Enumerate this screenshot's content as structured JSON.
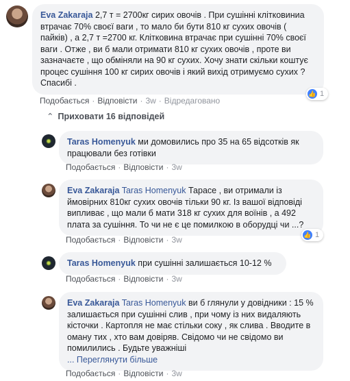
{
  "comments": [
    {
      "author": "Eva Zakaraja",
      "mention": "",
      "text": "2,7 т = 2700кг сирих овочів . При сушінні клітковиниа втрачає 70% своєї ваги , то мало би бути 810 кг сухих овочів ( пайків) , а 2,7 т =2700 кг. Клітковина втрачає при сушінні 70% своєї ваги . Отже , ви б мали отримати 810 кг сухих овочів , проте ви зазначаєте , що обміняли на 90 кг сухих. Хочу знати скільки коштує процес сушіння 100 кг сирих овочів і який вихід отримуємо сухих ? Спасибі .",
      "like": "Подобається",
      "reply": "Відповісти",
      "time": "3w",
      "edited": "Відредаговано",
      "reactions": "1"
    },
    {
      "author": "Taras Homenyuk",
      "mention": "",
      "text": "ми домовились про 35 на 65 відсотків як працювали без готівки",
      "like": "Подобається",
      "reply": "Відповісти",
      "time": "3w"
    },
    {
      "author": "Eva Zakaraja",
      "mention": "Taras Homenyuk",
      "text": "Тарасе , ви отримали із ймовірних 810кг сухих овочів тільки 90 кг. Із вашої відповіді випливає , що мали б мати 318 кг сухих для воїнів , а 492 плата за сушіння. То чи не є це помилкою в обoрудці чи ...?",
      "like": "Подобається",
      "reply": "Відповісти",
      "time": "3w",
      "reactions": "1"
    },
    {
      "author": "Taras Homenyuk",
      "mention": "",
      "text": "при сушінні залишається 10-12 %",
      "like": "Подобається",
      "reply": "Відповісти",
      "time": "3w"
    },
    {
      "author": "Eva Zakaraja",
      "mention": "Taras Homenyuk",
      "text": "ви б глянули у довідники : 15 % залишається при сушінні слив , при чому із них видаляють кісточки . Картопля не має стільки соку , як слива . Вводите в оману тих , хто вам довіряв. Свідомо чи не свідомо ви помилились . Будьте уважніші",
      "more": "... Переглянути більше",
      "like": "Подобається",
      "reply": "Відповісти",
      "time": "3w"
    }
  ],
  "hide_replies": "Приховати 16 відповідей",
  "icons": {
    "like": "like-thumb-icon",
    "arrow": "reply-arrow-icon"
  }
}
